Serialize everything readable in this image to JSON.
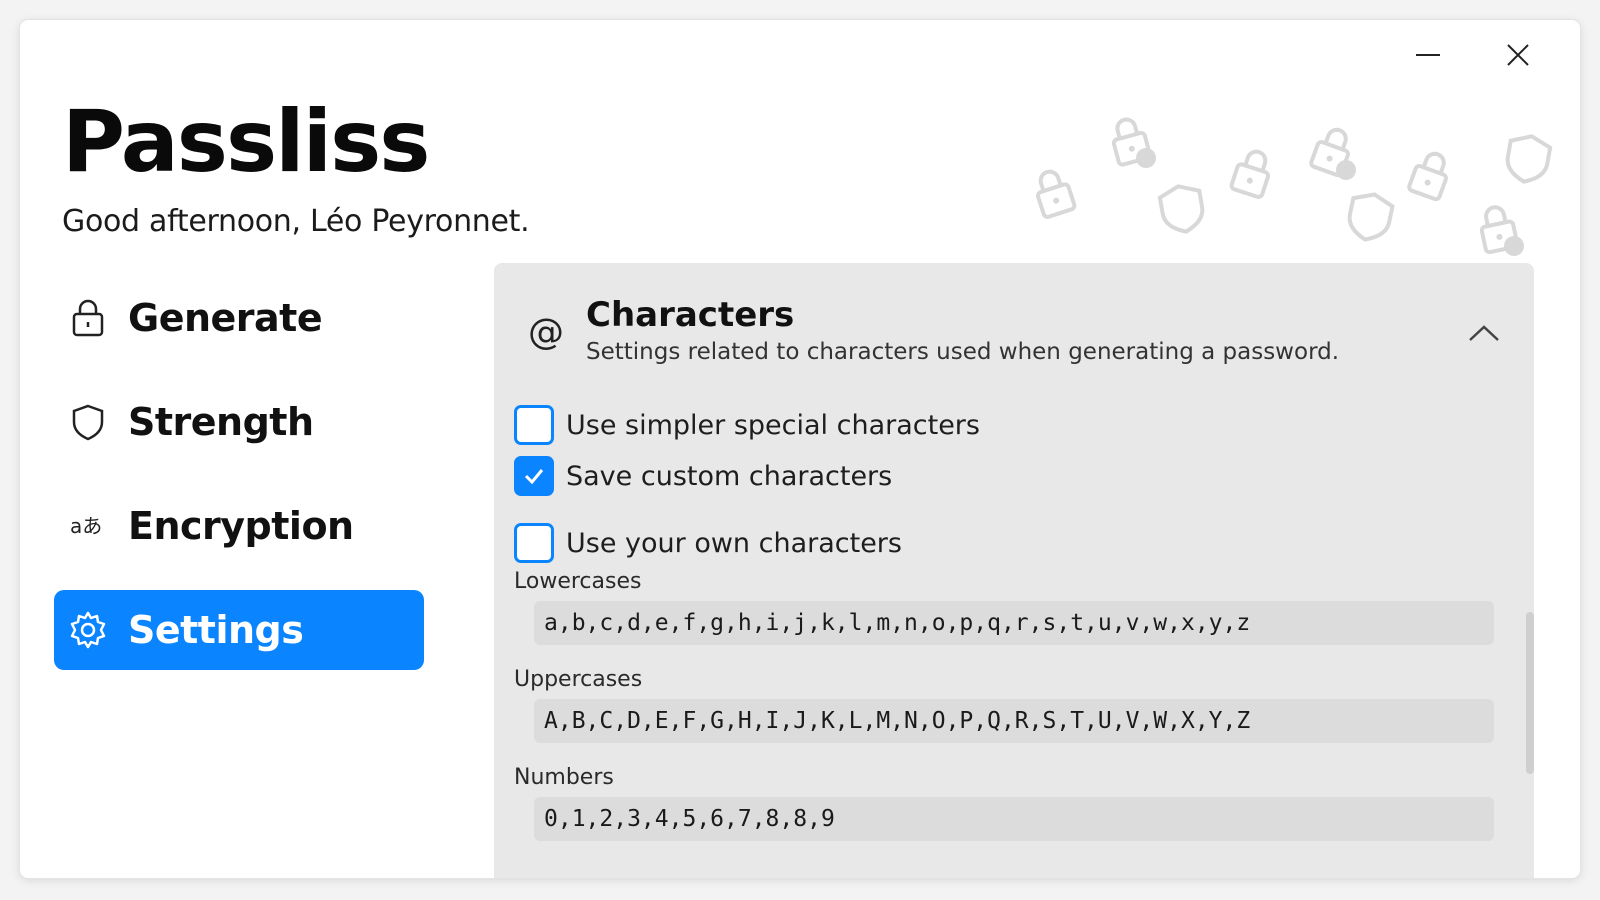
{
  "app": {
    "title": "Passliss",
    "greeting": "Good afternoon, Léo Peyronnet."
  },
  "window_controls": {
    "minimize_icon": "minimize-icon",
    "close_icon": "close-icon"
  },
  "nav": {
    "items": [
      {
        "label": "Generate",
        "icon": "lock-icon",
        "active": false
      },
      {
        "label": "Strength",
        "icon": "shield-icon",
        "active": false
      },
      {
        "label": "Encryption",
        "icon": "translate-icon",
        "active": false
      },
      {
        "label": "Settings",
        "icon": "gear-icon",
        "active": true
      }
    ]
  },
  "panel": {
    "icon": "at-icon",
    "icon_glyph": "@",
    "title": "Characters",
    "description": "Settings related to characters used when generating a password.",
    "checkboxes": [
      {
        "label": "Use simpler special characters",
        "checked": false
      },
      {
        "label": "Save custom characters",
        "checked": true
      },
      {
        "label": "Use your own characters",
        "checked": false
      }
    ],
    "fields": [
      {
        "label": "Lowercases",
        "value": "a,b,c,d,e,f,g,h,i,j,k,l,m,n,o,p,q,r,s,t,u,v,w,x,y,z"
      },
      {
        "label": "Uppercases",
        "value": "A,B,C,D,E,F,G,H,I,J,K,L,M,N,O,P,Q,R,S,T,U,V,W,X,Y,Z"
      },
      {
        "label": "Numbers",
        "value": "0,1,2,3,4,5,6,7,8,8,9"
      }
    ]
  },
  "colors": {
    "accent": "#0a84ff",
    "panel_bg": "#e8e8e8",
    "input_bg": "#dcdcdc"
  }
}
